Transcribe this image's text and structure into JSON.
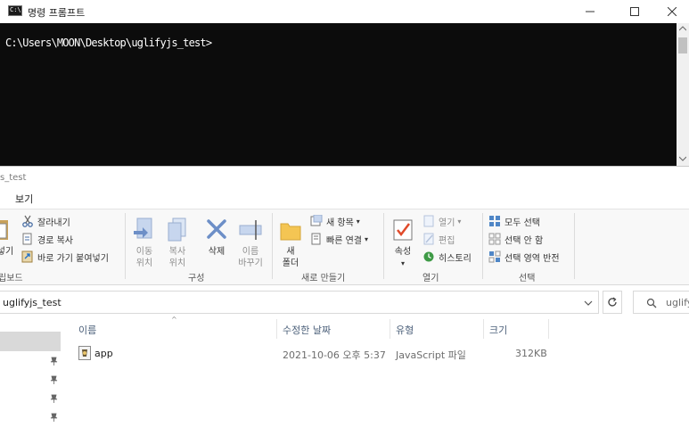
{
  "cmd": {
    "title": "명령 프롬프트",
    "console_line": "C:\\Users\\MOON\\Desktop\\uglifyjs_test>",
    "icon_text": "C:\\"
  },
  "explorer": {
    "title_partial": "s_test",
    "menu": {
      "view": "보기"
    },
    "ribbon": {
      "clipboard": {
        "cut": "잘라내기",
        "copy_path": "경로 복사",
        "paste_shortcut": "바로 가기 붙여넣기",
        "paste_partial": "넣기",
        "label_partial": "립보드"
      },
      "organize": {
        "move_to": [
          "이동",
          "위치"
        ],
        "copy_to": [
          "복사",
          "위치"
        ],
        "delete": "삭제",
        "rename": [
          "이름",
          "바꾸기"
        ],
        "label": "구성"
      },
      "new": {
        "new_folder": [
          "새",
          "폴더"
        ],
        "new_item": "새 항목",
        "easy_access": "빠른 연결",
        "label": "새로 만들기"
      },
      "open": {
        "properties": "속성",
        "open": "열기",
        "edit": "편집",
        "history": "히스토리",
        "label": "열기"
      },
      "select": {
        "select_all": "모두 선택",
        "select_none": "선택 안 함",
        "invert": "선택 영역 반전",
        "label": "선택"
      }
    },
    "address": {
      "path": "uglifyjs_test",
      "search_placeholder": "uglify"
    },
    "columns": {
      "name": "이름",
      "modified": "수정한 날짜",
      "type": "유형",
      "size": "크기"
    },
    "files": [
      {
        "name": "app",
        "modified": "2021-10-06 오후 5:37",
        "type": "JavaScript 파일",
        "size": "312KB"
      }
    ]
  },
  "colors": {
    "console_bg": "#0c0c0c",
    "console_fg": "#ffffff",
    "accent": "#1e6fc9"
  }
}
